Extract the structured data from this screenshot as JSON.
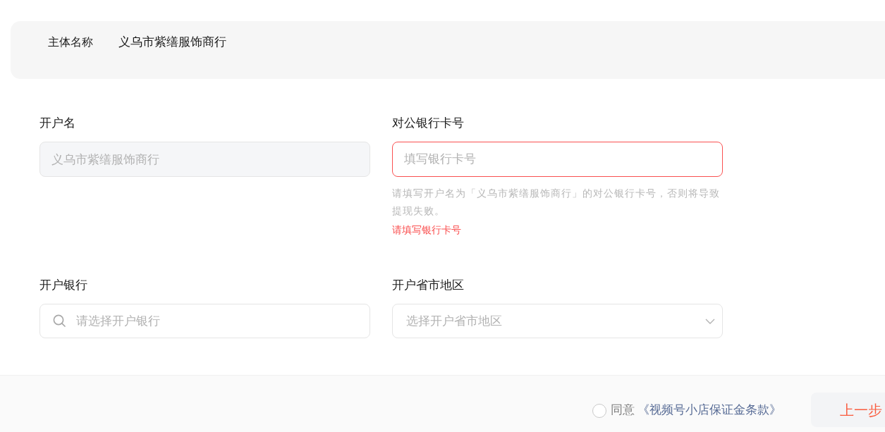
{
  "subject": {
    "label": "主体名称",
    "value": "义乌市紫缮服饰商行"
  },
  "fields": [
    {
      "kind": "text",
      "label": "开户名",
      "value": "义乌市紫缮服饰商行",
      "disabled": true,
      "invalid": false
    },
    {
      "kind": "text",
      "label": "对公银行卡号",
      "placeholder": "填写银行卡号",
      "disabled": false,
      "invalid": true,
      "hint": "请填写开户名为「义乌市紫缮服饰商行」的对公银行卡号，否则将导致提现失败。",
      "error": "请填写银行卡号"
    },
    {
      "kind": "search",
      "label": "开户银行",
      "placeholder": "请选择开户银行",
      "disabled": false,
      "invalid": false
    },
    {
      "kind": "select",
      "label": "开户省市地区",
      "placeholder": "选择开户省市地区",
      "disabled": false,
      "invalid": false
    }
  ],
  "footer": {
    "agree": {
      "checked": false,
      "label": "同意",
      "link": "《视频号小店保证金条款》"
    },
    "buttons": [
      "上一步"
    ]
  }
}
